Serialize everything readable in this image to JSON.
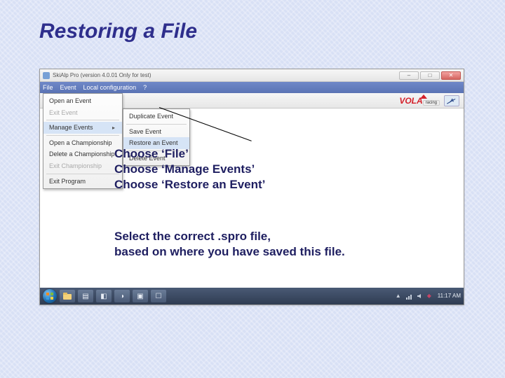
{
  "slide": {
    "title": "Restoring a File"
  },
  "window": {
    "title": "SkiAlp Pro (version 4.0.01 Only for test)"
  },
  "menubar": {
    "file": "File",
    "event": "Event",
    "local_config": "Local configuration",
    "help": "?"
  },
  "logos": {
    "vola": "VOLA",
    "vola_sub": "racing"
  },
  "file_menu": {
    "open_event": "Open an Event",
    "exit_event": "Exit Event",
    "manage_events": "Manage Events",
    "open_champ": "Open a Championship",
    "delete_champ": "Delete a Championship",
    "exit_champ": "Exit Championship",
    "exit_program": "Exit Program"
  },
  "submenu": {
    "duplicate": "Duplicate Event",
    "save": "Save Event",
    "restore": "Restore an Event",
    "delete": "Delete Event"
  },
  "instructions": {
    "l1": "Choose ‘File’",
    "l2": "Choose ‘Manage Events’",
    "l3": "Choose ‘Restore an Event’",
    "l4": "Select the correct .spro file,",
    "l5": "based on where you have saved this file."
  },
  "taskbar": {
    "time": "11:17 AM"
  },
  "win_controls": {
    "min": "–",
    "max": "□",
    "close": "✕"
  }
}
